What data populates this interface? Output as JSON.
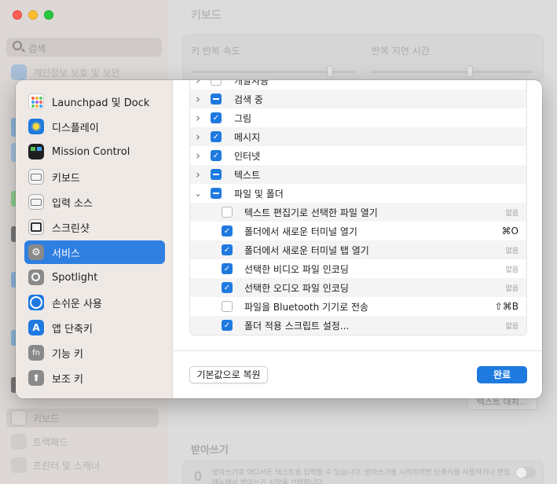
{
  "background": {
    "search_placeholder": "검색",
    "sidebar_items": {
      "privacy": "개인정보 보호 및 보안",
      "keyboard": "키보드",
      "trackpad": "트랙패드",
      "printer": "프린터 및 스캐너"
    },
    "title": "키보드",
    "key_repeat_rate": "키 반복 속도",
    "repeat_delay": "반복 지연 시간",
    "text_replace_button": "텍스트 대치...",
    "dictation_title": "받아쓰기",
    "dictation_text": "받아쓰기로 어디서든 텍스트를 입력할 수 있습니다. 받아쓰기를 시작하려면 단축키를 사용하거나 편집 메뉴에서 받아쓰기 시작을 선택합니다."
  },
  "sidebar": [
    {
      "label": "Launchpad 및 Dock",
      "icon": "launchpad-icon",
      "active": false
    },
    {
      "label": "디스플레이",
      "icon": "display-icon",
      "active": false
    },
    {
      "label": "Mission Control",
      "icon": "mission-control-icon",
      "active": false
    },
    {
      "label": "키보드",
      "icon": "keyboard-icon",
      "active": false
    },
    {
      "label": "입력 소스",
      "icon": "input-source-icon",
      "active": false
    },
    {
      "label": "스크린샷",
      "icon": "screenshot-icon",
      "active": false
    },
    {
      "label": "서비스",
      "icon": "services-icon",
      "active": true
    },
    {
      "label": "Spotlight",
      "icon": "spotlight-icon",
      "active": false
    },
    {
      "label": "손쉬운 사용",
      "icon": "accessibility-icon",
      "active": false
    },
    {
      "label": "앱 단축키",
      "icon": "app-shortcuts-icon",
      "active": false
    },
    {
      "label": "기능 키",
      "icon": "function-keys-icon",
      "active": false
    },
    {
      "label": "보조 키",
      "icon": "modifier-keys-icon",
      "active": false
    }
  ],
  "services": [
    {
      "label": "개발자용",
      "state": "off",
      "expandable": true,
      "expanded": false,
      "indent": false,
      "shortcut": ""
    },
    {
      "label": "검색 중",
      "state": "mixed",
      "expandable": true,
      "expanded": false,
      "indent": false,
      "shortcut": ""
    },
    {
      "label": "그림",
      "state": "on",
      "expandable": true,
      "expanded": false,
      "indent": false,
      "shortcut": ""
    },
    {
      "label": "메시지",
      "state": "on",
      "expandable": true,
      "expanded": false,
      "indent": false,
      "shortcut": ""
    },
    {
      "label": "인터넷",
      "state": "on",
      "expandable": true,
      "expanded": false,
      "indent": false,
      "shortcut": ""
    },
    {
      "label": "텍스트",
      "state": "mixed",
      "expandable": true,
      "expanded": false,
      "indent": false,
      "shortcut": ""
    },
    {
      "label": "파일 및 폴더",
      "state": "mixed",
      "expandable": true,
      "expanded": true,
      "indent": false,
      "shortcut": ""
    },
    {
      "label": "텍스트 편집기로 선택한 파일 열기",
      "state": "off",
      "expandable": false,
      "expanded": false,
      "indent": true,
      "shortcut": "없음"
    },
    {
      "label": "폴더에서 새로운 터미널 열기",
      "state": "on",
      "expandable": false,
      "expanded": false,
      "indent": true,
      "shortcut": "⌘O"
    },
    {
      "label": "폴더에서 새로운 터미널 탭 열기",
      "state": "on",
      "expandable": false,
      "expanded": false,
      "indent": true,
      "shortcut": "없음"
    },
    {
      "label": "선택한 비디오 파일 인코딩",
      "state": "on",
      "expandable": false,
      "expanded": false,
      "indent": true,
      "shortcut": "없음"
    },
    {
      "label": "선택한 오디오 파일 인코딩",
      "state": "on",
      "expandable": false,
      "expanded": false,
      "indent": true,
      "shortcut": "없음"
    },
    {
      "label": "파일을 Bluetooth 기기로 전송",
      "state": "off",
      "expandable": false,
      "expanded": false,
      "indent": true,
      "shortcut": "⇧⌘B"
    },
    {
      "label": "폴더 적용 스크립트 설정...",
      "state": "on",
      "expandable": false,
      "expanded": false,
      "indent": true,
      "shortcut": "없음"
    }
  ],
  "buttons": {
    "restore_defaults": "기본값으로 복원",
    "done": "완료"
  },
  "colors": {
    "accent": "#1f7ae0"
  }
}
